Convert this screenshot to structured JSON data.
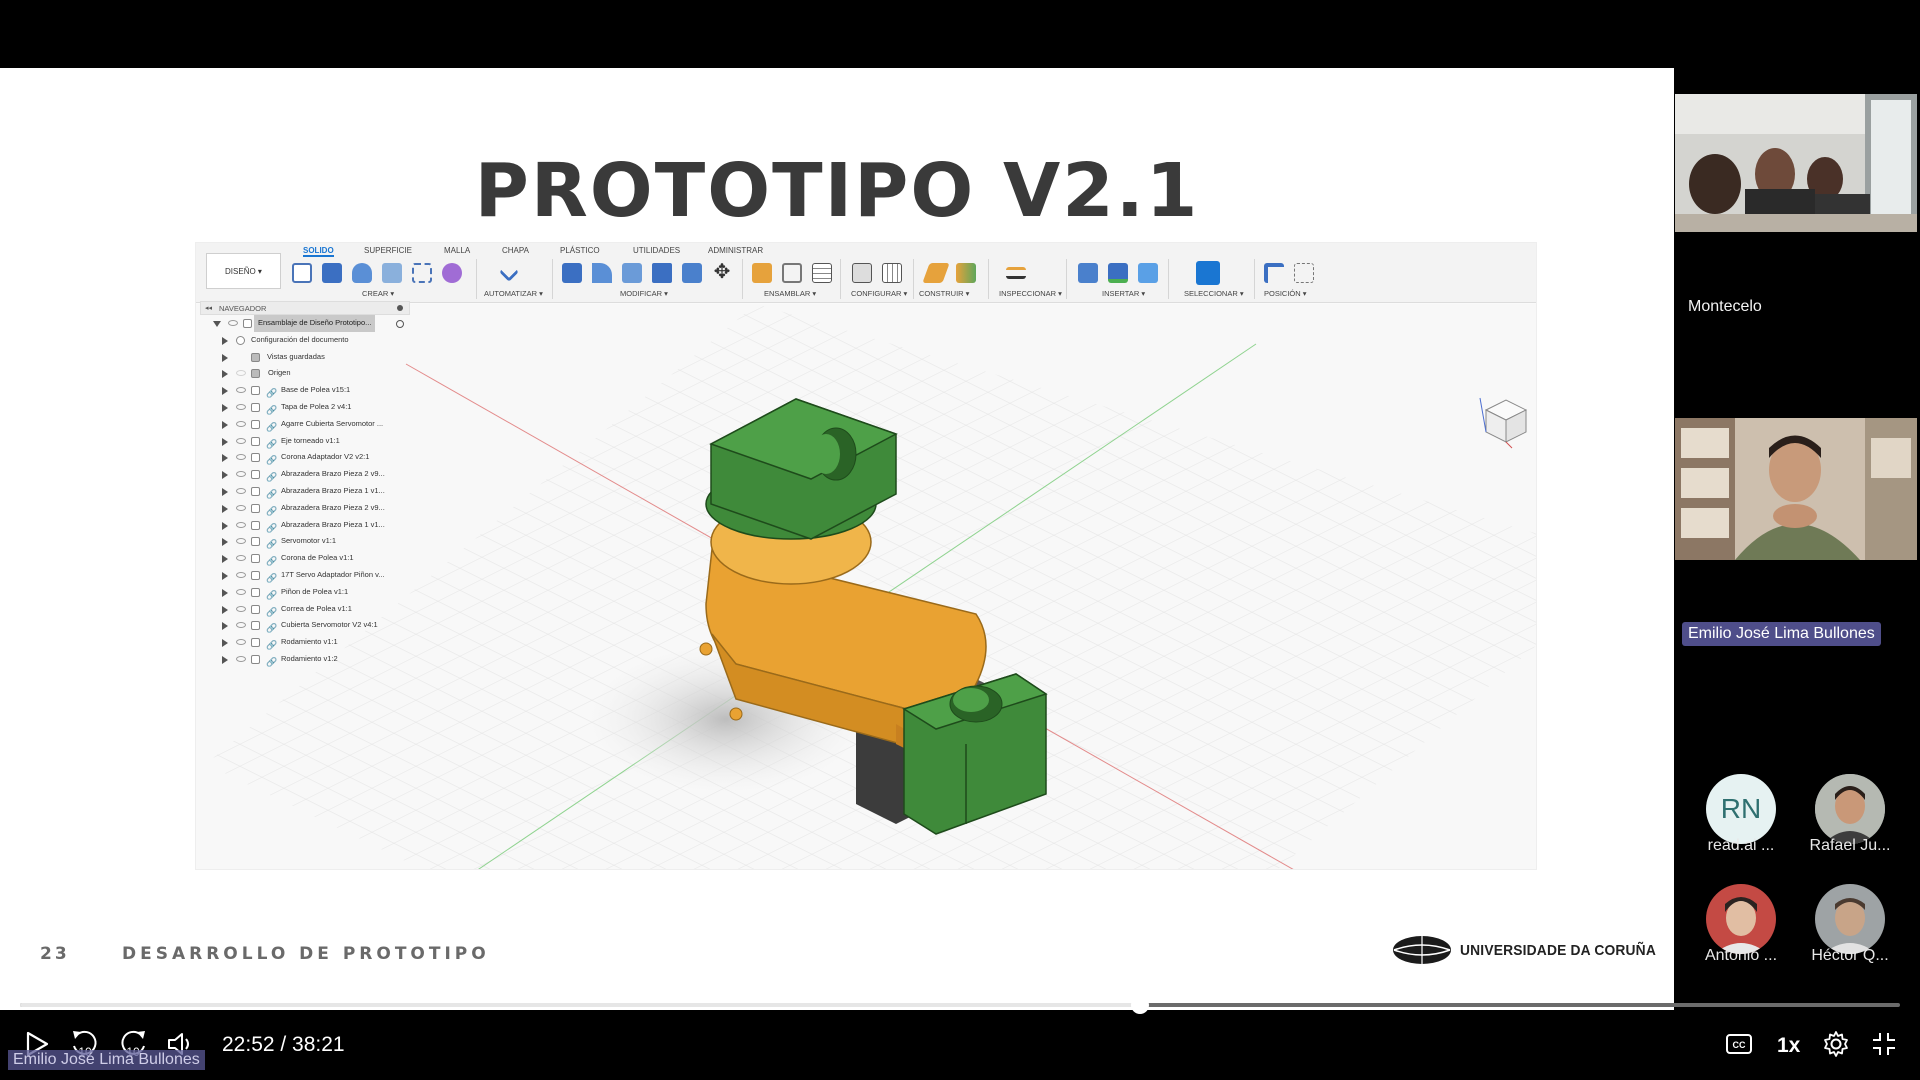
{
  "slide": {
    "title": "PROTOTIPO V2.1",
    "page_number": "23",
    "footer": "DESARROLLO DE PROTOTIPO",
    "university": "UNIVERSIDADE DA CORUÑA"
  },
  "fusion": {
    "tabs": [
      "SOLIDO",
      "SUPERFICIE",
      "MALLA",
      "CHAPA",
      "PLÁSTICO",
      "UTILIDADES",
      "ADMINISTRAR"
    ],
    "active_tab": "SOLIDO",
    "design_button": "DISEÑO ▾",
    "groups": [
      "CREAR ▾",
      "AUTOMATIZAR ▾",
      "MODIFICAR ▾",
      "ENSAMBLAR ▾",
      "CONFIGURAR ▾",
      "CONSTRUIR ▾",
      "INSPECCIONAR ▾",
      "INSERTAR ▾",
      "SELECCIONAR ▾",
      "POSICIÓN ▾"
    ],
    "browser_title": "NAVEGADOR",
    "browser_root": "Ensamblaje de Diseño Prototipo...",
    "browser_items": [
      "Configuración del documento",
      "Vistas guardadas",
      "Origen",
      "Base de Polea v15:1",
      "Tapa de Polea 2 v4:1",
      "Agarre Cubierta Servomotor ...",
      "Eje torneado v1:1",
      "Corona Adaptador V2 v2:1",
      "Abrazadera Brazo Pieza 2 v9...",
      "Abrazadera Brazo Pieza 1 v1...",
      "Abrazadera Brazo Pieza 2 v9...",
      "Abrazadera Brazo Pieza 1 v1...",
      "Servomotor v1:1",
      "Corona de Polea v1:1",
      "17T Servo Adaptador Piñon v...",
      "Piñon de Polea v1:1",
      "Correa de Polea v1:1",
      "Cubierta Servomotor V2 v4:1",
      "Rodamiento v1:1",
      "Rodamiento v1:2"
    ],
    "colors": {
      "green": "#3f8a3a",
      "orange": "#e9a232",
      "dark": "#3c3c3c"
    }
  },
  "participants": {
    "room_name": "Montecelo",
    "speaker": "Emilio José Lima Bullones",
    "others": [
      {
        "label": "read.ai ...",
        "initials": "RN"
      },
      {
        "label": "Rafael Ju..."
      },
      {
        "label": "Antonio ..."
      },
      {
        "label": "Héctor Q..."
      }
    ]
  },
  "player": {
    "time": "22:52 / 38:21",
    "progress": 0.596,
    "skip_back": "10",
    "skip_forward": "10",
    "speed": "1x",
    "caption_name": "Emilio José Lima Bullones"
  }
}
